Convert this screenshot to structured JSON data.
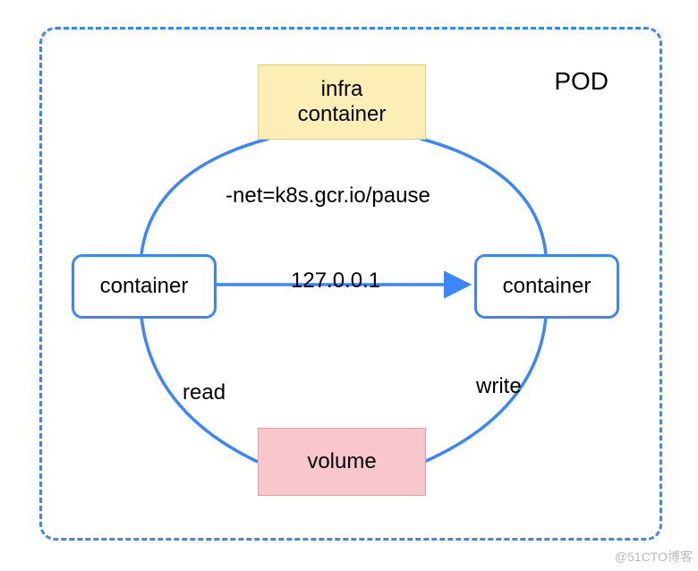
{
  "pod": {
    "label": "POD"
  },
  "nodes": {
    "infra": {
      "label": "infra\ncontainer"
    },
    "left": {
      "label": "container"
    },
    "right": {
      "label": "container"
    },
    "volume": {
      "label": "volume"
    }
  },
  "edges": {
    "net": {
      "label": "-net=k8s.gcr.io/pause"
    },
    "ip": {
      "label": "127.0.0.1"
    },
    "read": {
      "label": "read"
    },
    "write": {
      "label": "write"
    }
  },
  "colors": {
    "stroke": "#3a86ff",
    "infra_fill": "#fdeeb5",
    "volume_fill": "#f9c6cb"
  },
  "watermark": "@51CTO博客"
}
